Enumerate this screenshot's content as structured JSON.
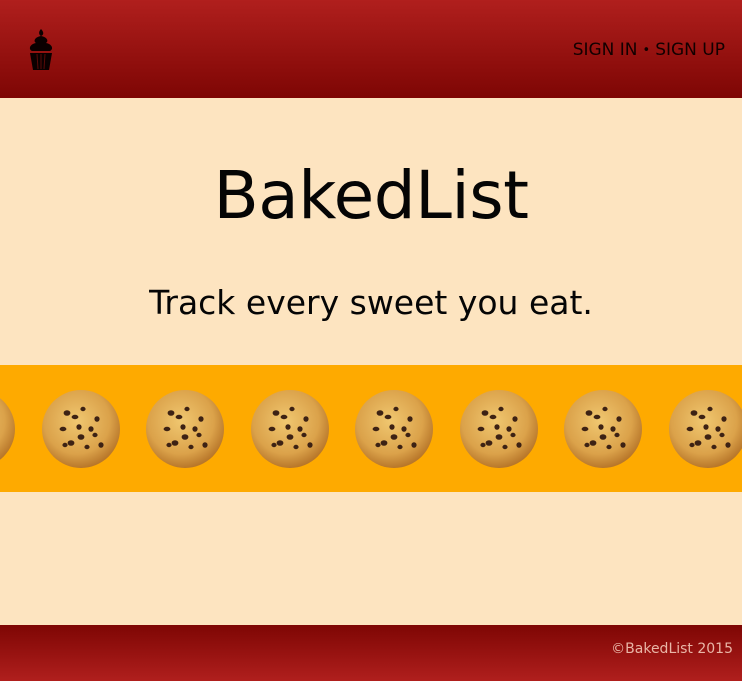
{
  "header": {
    "logo_icon": "cupcake-icon",
    "sign_in_label": "SIGN IN",
    "separator": "•",
    "sign_up_label": "SIGN UP"
  },
  "hero": {
    "title": "BakedList",
    "tagline": "Track every sweet you eat."
  },
  "band": {
    "icon": "cookie-icon",
    "cookie_count": 8
  },
  "footer": {
    "copyright": "©BakedList 2015"
  },
  "colors": {
    "header_top": "#b01f1d",
    "header_bottom": "#7e0604",
    "page_background": "#fde4c0",
    "band_background": "#feaa00"
  }
}
